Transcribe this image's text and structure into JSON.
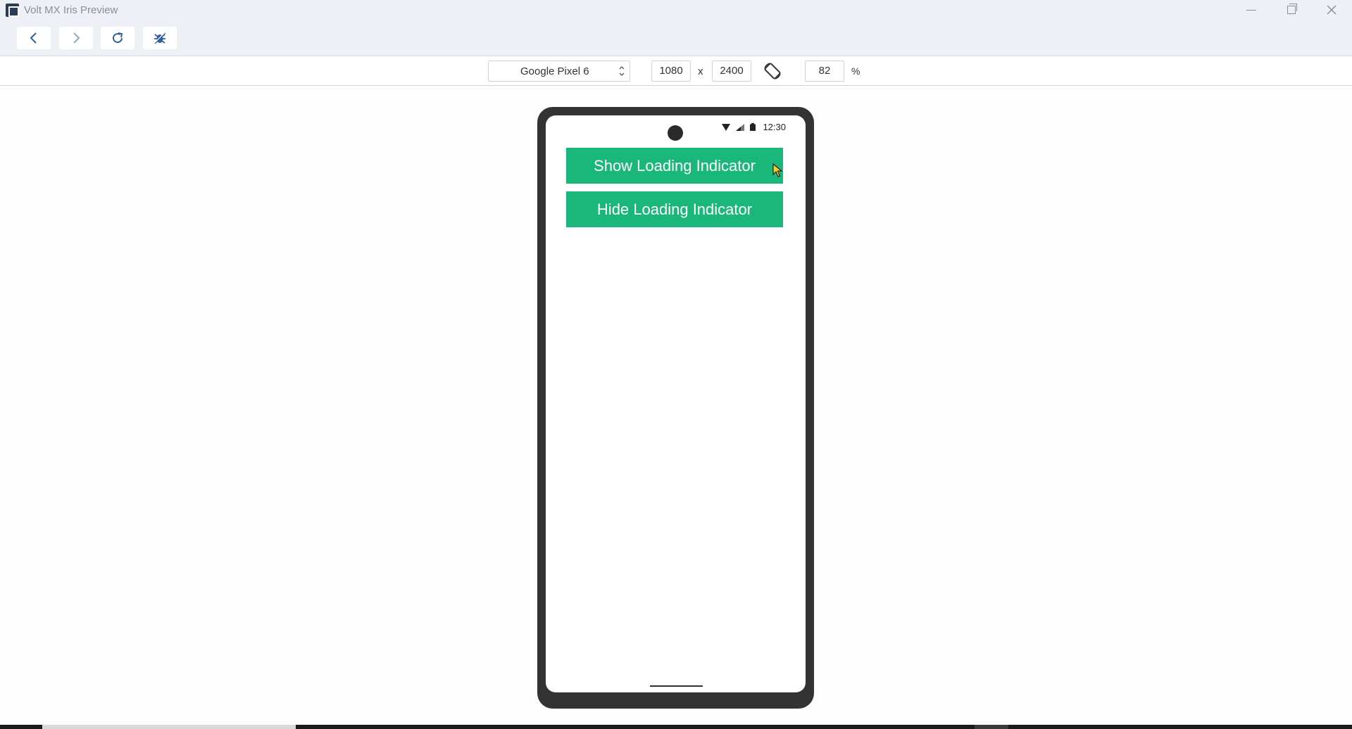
{
  "window": {
    "title": "Volt MX Iris Preview"
  },
  "device_bar": {
    "device": "Google Pixel 6",
    "width": "1080",
    "separator": "x",
    "height": "2400",
    "zoom": "82",
    "zoom_unit": "%"
  },
  "phone": {
    "status_time": "12:30",
    "buttons": [
      {
        "label": "Show Loading Indicator"
      },
      {
        "label": "Hide Loading Indicator"
      }
    ]
  },
  "colors": {
    "accent_green": "#1ab77a",
    "toolbar_icon": "#2f5f9e",
    "phone_frame": "#333333"
  },
  "icons": {
    "back": "chevron-left-icon",
    "forward": "chevron-right-icon",
    "reload": "refresh-icon",
    "debug": "bug-icon",
    "rotate": "rotate-device-icon"
  }
}
